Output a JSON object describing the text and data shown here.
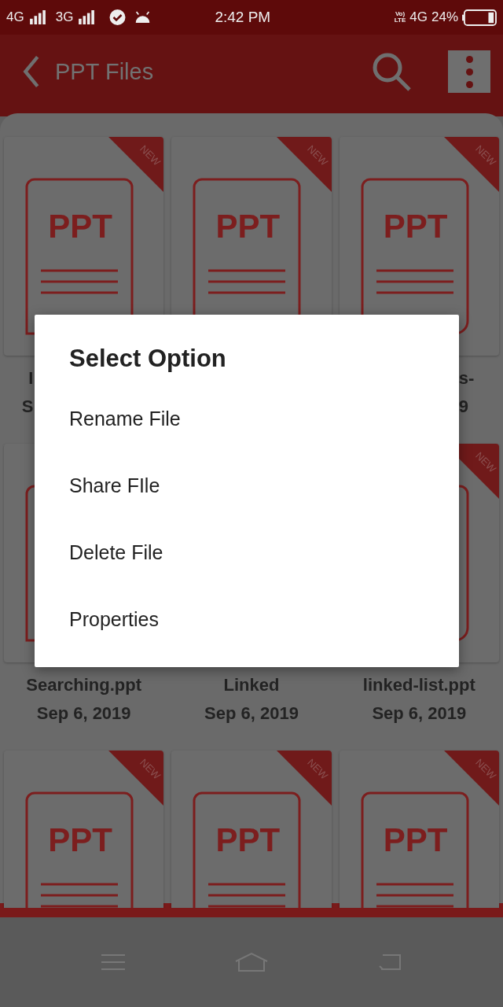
{
  "status_bar": {
    "left": [
      "4G",
      "3G"
    ],
    "time": "2:42 PM",
    "volte": [
      "Vo)",
      "LTE"
    ],
    "network": "4G",
    "battery": "24%"
  },
  "app_bar": {
    "title": "PPT Files"
  },
  "rows": [
    [
      {
        "label": "PPT",
        "badge": "NEW",
        "name": "I",
        "date": "S"
      },
      {
        "label": "PPT",
        "badge": "NEW"
      },
      {
        "label": "PPT",
        "badge": "NEW",
        "name": "s-",
        "date": "9"
      }
    ],
    [
      {},
      {
        "name": "Linked",
        "date": "Sep 6, 2019"
      },
      {
        "badge": "NEW"
      }
    ],
    [
      {
        "label": "PPT",
        "badge": "NEW"
      },
      {
        "label": "PPT",
        "badge": "NEW"
      },
      {
        "label": "PPT",
        "badge": "NEW"
      }
    ]
  ],
  "row2_first_caption": {
    "name": "Searching.ppt",
    "date": "Sep 6, 2019"
  },
  "row2_last_caption": {
    "name": "linked-list.ppt",
    "date": "Sep 6, 2019"
  },
  "dialog": {
    "title": "Select Option",
    "options": [
      "Rename File",
      "Share FIle",
      "Delete File",
      "Properties"
    ]
  }
}
